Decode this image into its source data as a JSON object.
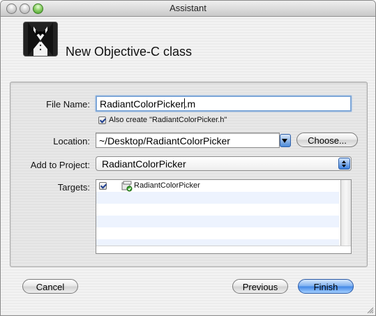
{
  "window": {
    "title": "Assistant"
  },
  "header": {
    "title": "New Objective-C class"
  },
  "form": {
    "file_name_label": "File Name:",
    "file_name_before_caret": "RadiantColorPicker",
    "file_name_after_caret": ".m",
    "also_create_label": "Also create \"RadiantColorPicker.h\"",
    "also_create_checked": true,
    "location_label": "Location:",
    "location_value": "~/Desktop/RadiantColorPicker",
    "choose_button": "Choose...",
    "add_to_project_label": "Add to Project:",
    "add_to_project_value": "RadiantColorPicker",
    "targets_label": "Targets:",
    "targets": [
      {
        "name": "RadiantColorPicker",
        "checked": true
      }
    ]
  },
  "footer": {
    "cancel_button": "Cancel",
    "previous_button": "Previous",
    "finish_button": "Finish"
  },
  "icons": {
    "logo": "tuxedo-icon",
    "target": "target-app-icon",
    "location_popup": "popup-arrow-icon",
    "project_stepper": "select-stepper-icon",
    "resize": "resize-grip-icon"
  },
  "colors": {
    "focus_ring": "#7ea7d8",
    "default_button": "#3f86e6",
    "alt_row": "#edf3fe"
  }
}
